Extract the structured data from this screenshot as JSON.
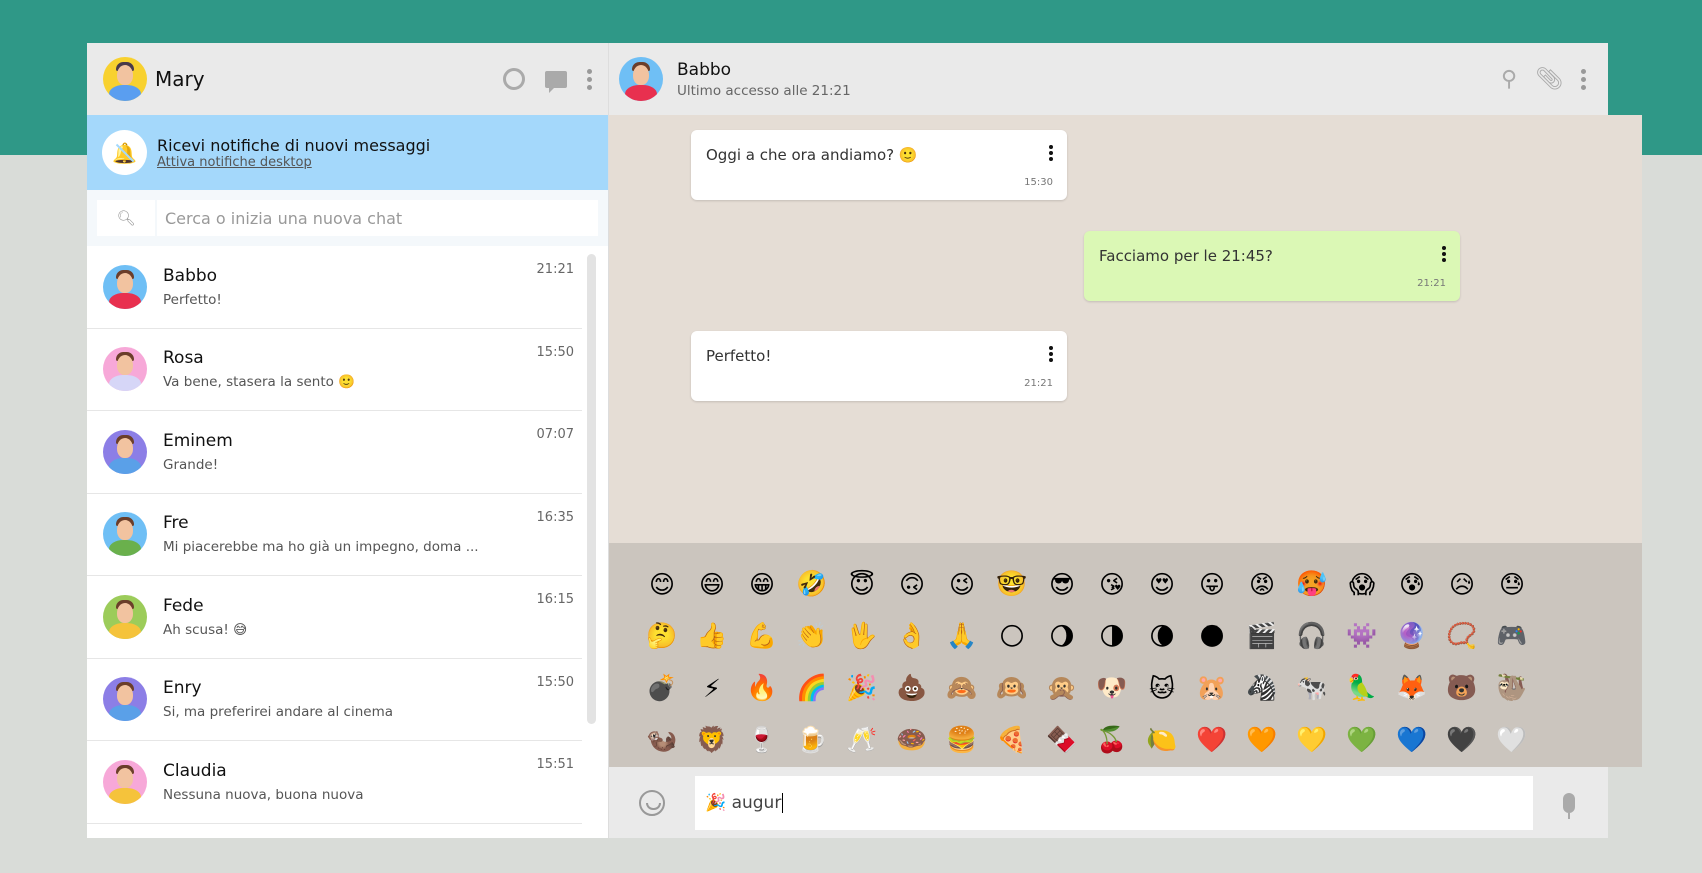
{
  "user": {
    "name": "Mary"
  },
  "notification": {
    "title": "Ricevi notifiche di nuovi messaggi",
    "link": "Attiva notifiche desktop"
  },
  "search": {
    "placeholder": "Cerca o inizia una nuova chat"
  },
  "chats": [
    {
      "name": "Babbo",
      "time": "21:21",
      "preview": "Perfetto!",
      "color": "#6fbff5",
      "shirt": "#e8304f"
    },
    {
      "name": "Rosa",
      "time": "15:50",
      "preview": "Va bene, stasera la sento 🙂",
      "color": "#f7a8d8",
      "shirt": "#d6d6f7"
    },
    {
      "name": "Eminem",
      "time": "07:07",
      "preview": "Grande!",
      "color": "#8c7ee6",
      "shirt": "#5aa0e8"
    },
    {
      "name": "Fre",
      "time": "16:35",
      "preview": "Mi piacerebbe ma ho già un impegno, doma ...",
      "color": "#6fbff5",
      "shirt": "#6ab04c"
    },
    {
      "name": "Fede",
      "time": "16:15",
      "preview": "Ah scusa! 😅",
      "color": "#9ccc5a",
      "shirt": "#f5c33b"
    },
    {
      "name": "Enry",
      "time": "15:50",
      "preview": "Si, ma preferirei andare al cinema",
      "color": "#8c7ee6",
      "shirt": "#5aa0e8"
    },
    {
      "name": "Claudia",
      "time": "15:51",
      "preview": "Nessuna nuova, buona nuova",
      "color": "#f7a8d8",
      "shirt": "#f5c33b"
    }
  ],
  "contact": {
    "name": "Babbo",
    "status": "Ultimo accesso alle 21:21"
  },
  "messages": [
    {
      "text": "Oggi a che ora andiamo? 🙂",
      "time": "15:30",
      "dir": "in"
    },
    {
      "text": "Facciamo per le 21:45?",
      "time": "21:21",
      "dir": "out"
    },
    {
      "text": "Perfetto!",
      "time": "21:21",
      "dir": "in"
    }
  ],
  "emojis": [
    "😊",
    "😄",
    "😁",
    "🤣",
    "😇",
    "🙃",
    "😉",
    "🤓",
    "😎",
    "😘",
    "😍",
    "😛",
    "😡",
    "🥵",
    "😱",
    "😰",
    "😥",
    "😓",
    "🤔",
    "👍",
    "💪",
    "👏",
    "🖖",
    "👌",
    "🙏",
    "🌕",
    "🌖",
    "🌗",
    "🌘",
    "🌑",
    "🎬",
    "🎧",
    "👾",
    "🔮",
    "📿",
    "🎮",
    "💣",
    "⚡",
    "🔥",
    "🌈",
    "🎉",
    "💩",
    "🙈",
    "🙉",
    "🙊",
    "🐶",
    "🐱",
    "🐹",
    "🦓",
    "🐄",
    "🦜",
    "🦊",
    "🐻",
    "🦥",
    "🦦",
    "🦁",
    "🍷",
    "🍺",
    "🥂",
    "🍩",
    "🍔",
    "🍕",
    "🍫",
    "🍒",
    "🍋",
    "❤️",
    "🧡",
    "💛",
    "💚",
    "💙",
    "🖤",
    "🤍"
  ],
  "composer": {
    "value": "🎉 augur"
  },
  "colors": {
    "band": "#2f9887",
    "notification": "#a4d8fb",
    "outgoing": "#dbf8b5"
  }
}
